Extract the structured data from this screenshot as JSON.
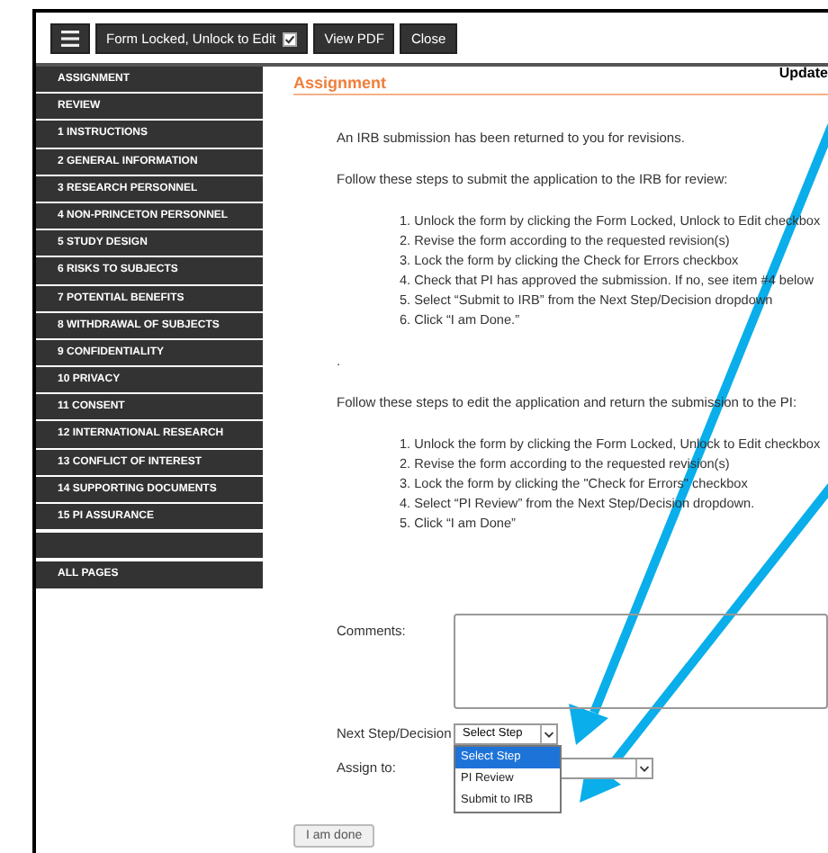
{
  "toolbar": {
    "buttons": [
      {
        "kind": "menu"
      },
      {
        "kind": "toggle",
        "label": "Form Locked, Unlock to Edit",
        "checked": true
      },
      {
        "kind": "text",
        "label": "View PDF"
      },
      {
        "kind": "text",
        "label": "Close"
      }
    ],
    "updated_label": "Update"
  },
  "sidebar": {
    "items": [
      "ASSIGNMENT",
      "REVIEW",
      "1 INSTRUCTIONS",
      "2 GENERAL INFORMATION",
      "3 RESEARCH PERSONNEL",
      "4 NON-PRINCETON PERSONNEL",
      "5 STUDY DESIGN",
      "6 RISKS TO SUBJECTS",
      "7 POTENTIAL BENEFITS",
      "8 WITHDRAWAL OF SUBJECTS",
      "9 CONFIDENTIALITY",
      "10 PRIVACY",
      "11 CONSENT",
      "12 INTERNATIONAL RESEARCH",
      "13 CONFLICT OF INTEREST",
      "14 SUPPORTING DOCUMENTS",
      "15 PI ASSURANCE"
    ],
    "all_pages": "ALL PAGES"
  },
  "content": {
    "heading": "Assignment",
    "blocks": [
      {
        "kind": "paragraph",
        "text": "An IRB submission has been returned to you for revisions."
      },
      {
        "kind": "paragraph",
        "text": "Follow these steps to submit the application to the IRB for review:"
      },
      {
        "kind": "list",
        "items": [
          "1. Unlock the form by clicking the Form Locked, Unlock to Edit checkbox",
          "2. Revise the form according to the requested revision(s)",
          "3. Lock the form by clicking the Check for Errors checkbox",
          "4. Check that PI has approved the submission. If no, see item #4 below",
          "5. Select “Submit to IRB” from the Next Step/Decision dropdown",
          "6. Click “I am Done.”"
        ]
      },
      {
        "kind": "paragraph",
        "text": "."
      },
      {
        "kind": "paragraph",
        "text": "Follow these steps to edit the application and return the submission to the PI:"
      },
      {
        "kind": "list",
        "items": [
          "1. Unlock the form by clicking the Form Locked, Unlock to Edit checkbox",
          "2. Revise the form according to the requested revision(s)",
          "3. Lock the form by clicking the \"Check for Errors\" checkbox",
          "4. Select “PI Review” from the Next Step/Decision dropdown.",
          "5. Click “I am Done”"
        ]
      }
    ]
  },
  "form": {
    "comments_label": "Comments:",
    "next_step_label": "Next Step/Decision",
    "next_step_value": "Select Step",
    "options": [
      {
        "label": "Select Step",
        "selected": true
      },
      {
        "label": "PI Review",
        "selected": false
      },
      {
        "label": "Submit to IRB",
        "selected": false
      }
    ],
    "assign_label": "Assign to:",
    "done_button": "I am done"
  }
}
